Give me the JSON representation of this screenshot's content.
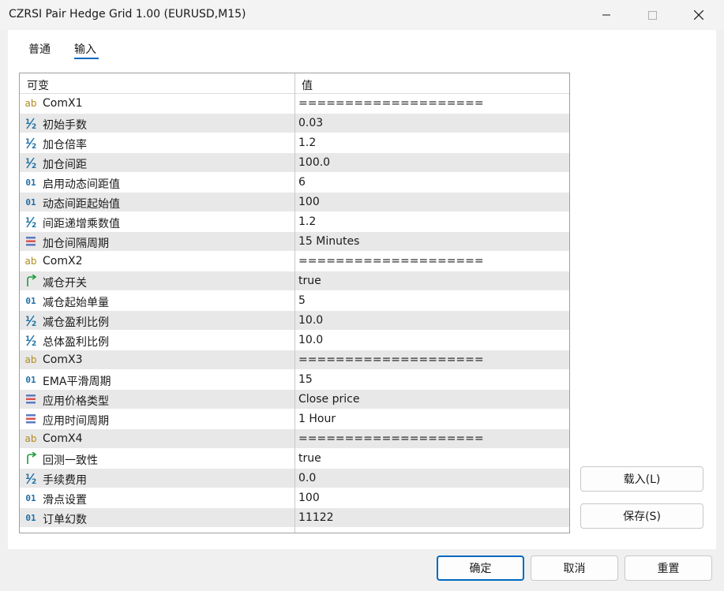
{
  "window": {
    "title": "CZRSI Pair Hedge Grid 1.00 (EURUSD,M15)"
  },
  "tabs": [
    {
      "label": "普通",
      "active": false
    },
    {
      "label": "输入",
      "active": true
    }
  ],
  "grid": {
    "header": {
      "name": "可变",
      "value": "值"
    },
    "rows": [
      {
        "icon": "ab",
        "name": "ComX1",
        "value": "===================="
      },
      {
        "icon": "half",
        "name": "初始手数",
        "value": "0.03"
      },
      {
        "icon": "half",
        "name": "加仓倍率",
        "value": "1.2"
      },
      {
        "icon": "half",
        "name": "加仓间距",
        "value": "100.0"
      },
      {
        "icon": "01",
        "name": "启用动态间距值",
        "value": "6"
      },
      {
        "icon": "01",
        "name": "动态间距起始值",
        "value": "100"
      },
      {
        "icon": "half",
        "name": "间距递增乘数值",
        "value": "1.2"
      },
      {
        "icon": "enum",
        "name": "加仓间隔周期",
        "value": "15 Minutes"
      },
      {
        "icon": "ab",
        "name": "ComX2",
        "value": "===================="
      },
      {
        "icon": "bool",
        "name": "减仓开关",
        "value": "true"
      },
      {
        "icon": "01",
        "name": "减仓起始单量",
        "value": "5"
      },
      {
        "icon": "half",
        "name": "减仓盈利比例",
        "value": "10.0"
      },
      {
        "icon": "half",
        "name": "总体盈利比例",
        "value": "10.0"
      },
      {
        "icon": "ab",
        "name": "ComX3",
        "value": "===================="
      },
      {
        "icon": "01",
        "name": "EMA平滑周期",
        "value": "15"
      },
      {
        "icon": "enum",
        "name": "应用价格类型",
        "value": "Close price"
      },
      {
        "icon": "enum",
        "name": "应用时间周期",
        "value": "1 Hour"
      },
      {
        "icon": "ab",
        "name": "ComX4",
        "value": "===================="
      },
      {
        "icon": "bool",
        "name": "回测一致性",
        "value": "true"
      },
      {
        "icon": "half",
        "name": "手续费用",
        "value": "0.0"
      },
      {
        "icon": "01",
        "name": "滑点设置",
        "value": "100"
      },
      {
        "icon": "01",
        "name": "订单幻数",
        "value": "11122"
      }
    ]
  },
  "side_buttons": {
    "load": "载入(L)",
    "save": "保存(S)"
  },
  "footer": {
    "ok": "确定",
    "cancel": "取消",
    "reset": "重置"
  },
  "colors": {
    "accent": "#0067c0",
    "row_alt": "#e8e8e8"
  }
}
